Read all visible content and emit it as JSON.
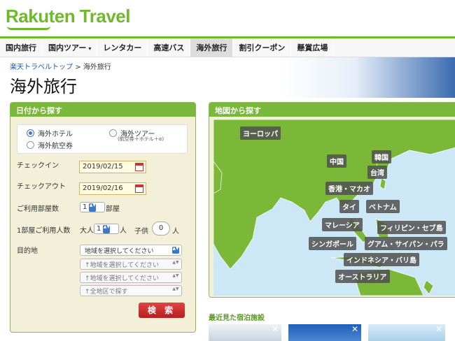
{
  "header": {
    "logo": "Rakuten Travel"
  },
  "nav": [
    "国内旅行",
    "国内ツアー",
    "レンタカー",
    "高速バス",
    "海外旅行",
    "割引クーポン",
    "懸賞広場"
  ],
  "nav_caret": "▾",
  "breadcrumb": {
    "home": "楽天トラベルトップ",
    "sep": ">",
    "current": "海外旅行"
  },
  "page_title": "海外旅行",
  "date_search": {
    "title": "日付から探す",
    "radio_hotel": "海外ホテル",
    "radio_tour": "海外ツアー",
    "radio_tour_note": "(航空券＋ホテル＋α)",
    "radio_air": "海外航空券",
    "checkin_label": "チェックイン",
    "checkin_value": "2019/02/15",
    "checkout_label": "チェックアウト",
    "checkout_value": "2019/02/16",
    "rooms_label": "ご利用部屋数",
    "rooms_value": "1",
    "rooms_unit": "部屋",
    "guests_label": "1部屋ご利用人数",
    "adult_label": "大人",
    "adult_value": "1",
    "adult_unit": "人",
    "child_label": "子供",
    "child_value": "0",
    "child_unit": "人",
    "dest_label": "目的地",
    "dest_select_1": "地域を選択してください",
    "dest_select_2": "↑地域を選択してください",
    "dest_select_3": "↑地域を選択してください",
    "dest_select_4": "↑全地区で探す",
    "search_button": "検 索"
  },
  "map_search": {
    "title": "地図から探す",
    "labels": {
      "europe": "ヨーロッパ",
      "china": "中国",
      "korea": "韓国",
      "taiwan": "台湾",
      "hongkong": "香港・マカオ",
      "thailand": "タイ",
      "vietnam": "ベトナム",
      "malaysia": "マレーシア",
      "philippines": "フィリピン・セブ島",
      "singapore": "シンガポール",
      "guam": "グアム・サイパン・パラ",
      "indonesia": "インドネシア・バリ島",
      "australia": "オーストラリア"
    }
  },
  "recent": {
    "title": "最近見た宿泊施設",
    "close": "✕"
  },
  "colors": {
    "brand_green": "#6fb92c",
    "search_red": "#c62828",
    "link_blue": "#1e5aa8"
  }
}
